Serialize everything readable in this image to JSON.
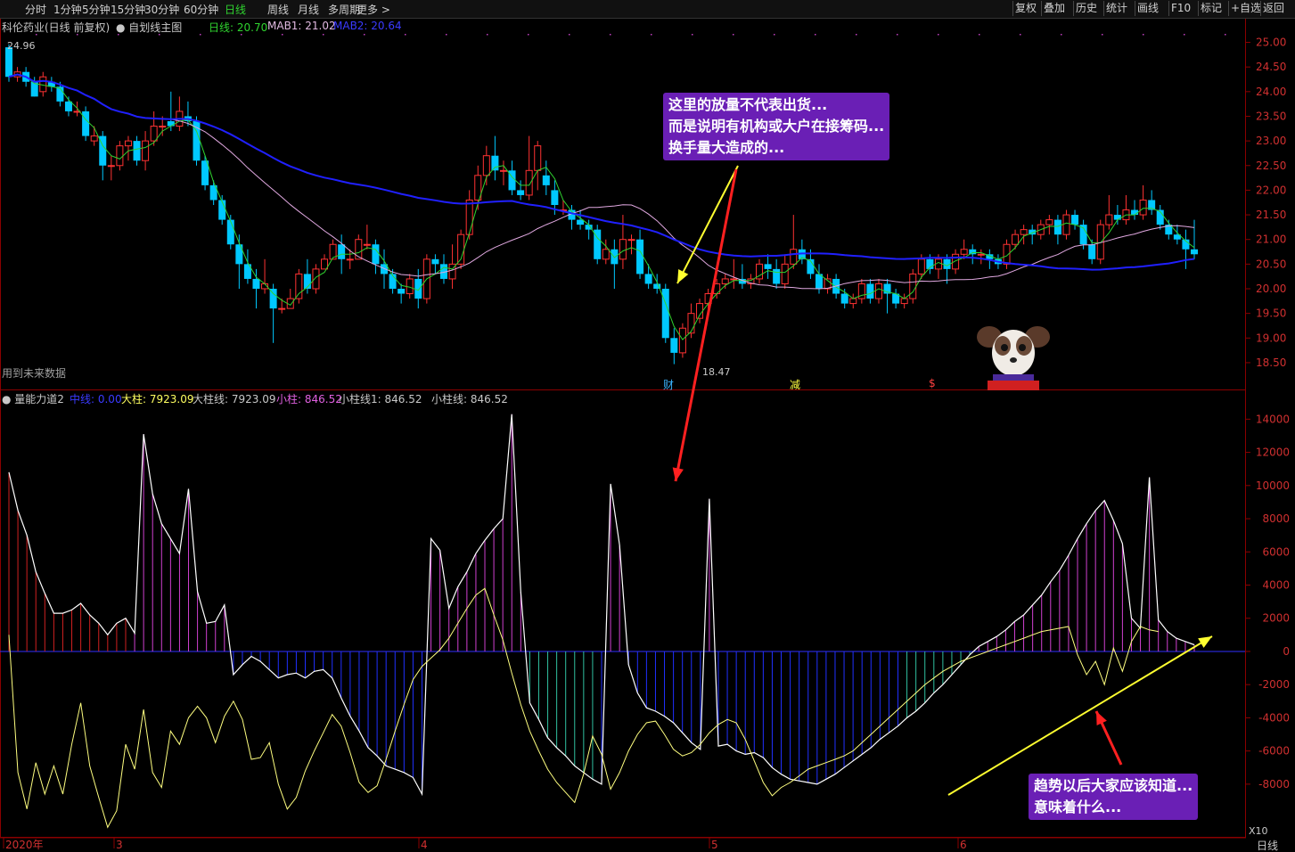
{
  "toolbar": {
    "periods": [
      "分时",
      "1分钟",
      "5分钟",
      "15分钟",
      "30分钟",
      "60分钟",
      "日线",
      "周线",
      "月线",
      "多周期",
      "更多 >"
    ],
    "active_period": "日线",
    "right_buttons": [
      "复权",
      "叠加",
      "历史",
      "统计",
      "画线",
      "F10",
      "标记",
      "+自选",
      "返回"
    ]
  },
  "main_legend": {
    "stock": "科伦药业(日线 前复权)",
    "template": "自划线主图",
    "ma_day": "日线: 20.70",
    "mab1": "MAB1: 21.02",
    "mab2": "MAB2: 20.64",
    "high_label": "24.96",
    "low_label": "18.47",
    "future_note": "用到未来数据"
  },
  "markers": [
    "财",
    "减",
    "$"
  ],
  "sub_legend": {
    "name": "量能力道2",
    "mid": "中线: 0.00",
    "big": "大柱: 7923.09",
    "big_line": "大柱线: 7923.09",
    "small": "小柱: 846.52",
    "small_line1": "小柱线1: 846.52",
    "small_line": "小柱线: 846.52"
  },
  "annotations": {
    "top": [
      "这里的放量不代表出货...",
      "而是说明有机构或大户在接筹码...",
      "换手量大造成的..."
    ],
    "bottom": [
      "趋势以后大家应该知道...",
      "意味着什么..."
    ]
  },
  "x_axis": {
    "labels": [
      "2020年",
      "3",
      "4",
      "5",
      "6"
    ],
    "period_label": "日线",
    "scale": "X10"
  },
  "colors": {
    "up": "#ff3232",
    "down": "#00c8ff",
    "ma_day": "#2fd32f",
    "mab1": "#e0a8e0",
    "mab2": "#2020ff",
    "bubble": "#6a1fb5"
  },
  "chart_data": [
    {
      "type": "candlestick",
      "y_ticks": [
        "25.00",
        "24.50",
        "24.00",
        "23.50",
        "23.00",
        "22.50",
        "22.00",
        "21.50",
        "21.00",
        "20.50",
        "20.00",
        "19.50",
        "19.00",
        "18.50"
      ],
      "ylim": [
        18.3,
        25.1
      ],
      "candles": [
        [
          24.9,
          24.3,
          24.96,
          24.2
        ],
        [
          24.3,
          24.4,
          24.5,
          24.2
        ],
        [
          24.4,
          24.2,
          24.5,
          24.1
        ],
        [
          24.2,
          23.9,
          24.3,
          23.9
        ],
        [
          24.0,
          24.3,
          24.4,
          23.9
        ],
        [
          24.2,
          24.1,
          24.3,
          24.0
        ],
        [
          24.1,
          23.8,
          24.2,
          23.7
        ],
        [
          23.8,
          23.6,
          23.9,
          23.5
        ],
        [
          23.6,
          23.6,
          23.8,
          23.5
        ],
        [
          23.6,
          23.1,
          23.7,
          23.0
        ],
        [
          23.0,
          23.1,
          23.3,
          22.9
        ],
        [
          23.1,
          22.5,
          23.2,
          22.2
        ],
        [
          22.5,
          22.5,
          22.7,
          22.2
        ],
        [
          22.5,
          22.9,
          23.0,
          22.4
        ],
        [
          22.9,
          23.0,
          23.1,
          22.6
        ],
        [
          23.0,
          22.6,
          23.1,
          22.5
        ],
        [
          22.6,
          23.0,
          23.2,
          22.4
        ],
        [
          23.0,
          23.3,
          23.6,
          22.9
        ],
        [
          23.3,
          23.3,
          23.5,
          23.1
        ],
        [
          23.4,
          23.3,
          24.0,
          23.2
        ],
        [
          23.3,
          23.6,
          23.9,
          23.2
        ],
        [
          23.5,
          23.4,
          23.8,
          23.3
        ],
        [
          23.4,
          22.6,
          23.5,
          22.5
        ],
        [
          22.6,
          22.1,
          22.7,
          22.0
        ],
        [
          22.1,
          21.8,
          22.2,
          21.7
        ],
        [
          21.8,
          21.4,
          21.9,
          21.3
        ],
        [
          21.4,
          20.9,
          21.5,
          20.8
        ],
        [
          20.9,
          20.5,
          21.1,
          20.0
        ],
        [
          20.5,
          20.2,
          20.8,
          20.1
        ],
        [
          20.2,
          20.0,
          20.4,
          19.6
        ],
        [
          20.0,
          20.1,
          20.6,
          19.9
        ],
        [
          20.0,
          19.6,
          20.1,
          18.9
        ],
        [
          19.6,
          19.6,
          19.8,
          19.5
        ],
        [
          19.6,
          19.8,
          20.0,
          19.7
        ],
        [
          19.8,
          20.3,
          20.4,
          19.7
        ],
        [
          20.3,
          20.0,
          20.6,
          19.9
        ],
        [
          20.0,
          20.4,
          20.5,
          19.9
        ],
        [
          20.4,
          20.6,
          20.7,
          20.4
        ],
        [
          20.6,
          20.9,
          21.0,
          20.6
        ],
        [
          20.9,
          20.6,
          21.1,
          20.3
        ],
        [
          20.6,
          20.6,
          20.8,
          20.4
        ],
        [
          20.6,
          21.0,
          21.1,
          20.6
        ],
        [
          20.9,
          20.9,
          21.3,
          20.8
        ],
        [
          20.9,
          20.5,
          21.0,
          20.3
        ],
        [
          20.5,
          20.3,
          20.8,
          20.0
        ],
        [
          20.3,
          20.0,
          20.4,
          19.9
        ],
        [
          20.0,
          19.9,
          20.1,
          19.7
        ],
        [
          19.9,
          20.2,
          20.3,
          19.8
        ],
        [
          20.2,
          19.8,
          20.4,
          19.6
        ],
        [
          19.8,
          20.6,
          20.7,
          19.7
        ],
        [
          20.6,
          20.5,
          20.7,
          20.3
        ],
        [
          20.5,
          20.2,
          20.7,
          20.1
        ],
        [
          20.2,
          20.5,
          20.9,
          20.0
        ],
        [
          20.5,
          21.1,
          21.2,
          20.4
        ],
        [
          21.1,
          21.8,
          22.0,
          21.0
        ],
        [
          21.8,
          22.3,
          22.5,
          21.6
        ],
        [
          22.3,
          22.7,
          22.9,
          22.1
        ],
        [
          22.7,
          22.4,
          23.1,
          22.2
        ],
        [
          22.4,
          22.4,
          22.6,
          22.1
        ],
        [
          22.4,
          22.0,
          22.6,
          21.9
        ],
        [
          22.0,
          21.9,
          22.2,
          21.8
        ],
        [
          21.9,
          22.4,
          23.1,
          21.8
        ],
        [
          22.4,
          22.9,
          23.0,
          22.0
        ],
        [
          22.3,
          22.1,
          22.6,
          21.9
        ],
        [
          22.0,
          21.7,
          22.2,
          21.5
        ],
        [
          21.6,
          21.6,
          21.8,
          21.5
        ],
        [
          21.6,
          21.4,
          21.7,
          21.2
        ],
        [
          21.4,
          21.3,
          21.6,
          21.2
        ],
        [
          21.3,
          21.2,
          21.4,
          21.0
        ],
        [
          21.2,
          20.6,
          21.3,
          20.5
        ],
        [
          20.6,
          20.8,
          21.0,
          20.5
        ],
        [
          20.8,
          20.5,
          21.0,
          20.0
        ],
        [
          20.6,
          21.0,
          21.5,
          20.4
        ],
        [
          21.0,
          21.0,
          21.1,
          20.7
        ],
        [
          21.0,
          20.3,
          21.2,
          20.2
        ],
        [
          20.3,
          20.1,
          20.5,
          20.0
        ],
        [
          20.1,
          20.0,
          20.3,
          19.9
        ],
        [
          20.0,
          19.0,
          20.1,
          18.9
        ],
        [
          19.0,
          18.7,
          19.2,
          18.47
        ],
        [
          18.7,
          19.2,
          19.3,
          18.6
        ],
        [
          19.1,
          19.5,
          19.7,
          19.0
        ],
        [
          19.4,
          19.7,
          19.8,
          19.3
        ],
        [
          19.7,
          19.9,
          20.0,
          19.6
        ],
        [
          19.9,
          20.1,
          20.2,
          19.8
        ],
        [
          20.1,
          20.2,
          20.3,
          20.0
        ],
        [
          20.2,
          20.2,
          20.6,
          20.0
        ],
        [
          20.2,
          20.1,
          20.5,
          20.0
        ],
        [
          20.1,
          20.2,
          20.3,
          20.0
        ],
        [
          20.2,
          20.5,
          20.6,
          20.1
        ],
        [
          20.5,
          20.4,
          20.7,
          20.2
        ],
        [
          20.4,
          20.1,
          20.6,
          20.0
        ],
        [
          20.1,
          20.5,
          20.7,
          20.0
        ],
        [
          20.5,
          20.8,
          21.5,
          20.4
        ],
        [
          20.8,
          20.6,
          21.0,
          20.5
        ],
        [
          20.6,
          20.3,
          20.8,
          20.2
        ],
        [
          20.3,
          20.0,
          20.5,
          19.9
        ],
        [
          20.0,
          20.2,
          20.3,
          19.9
        ],
        [
          20.2,
          19.9,
          20.3,
          19.8
        ],
        [
          19.9,
          19.7,
          20.0,
          19.6
        ],
        [
          19.7,
          19.8,
          19.9,
          19.6
        ],
        [
          19.8,
          20.1,
          20.2,
          19.7
        ],
        [
          20.1,
          19.8,
          20.2,
          19.7
        ],
        [
          19.8,
          20.1,
          20.2,
          19.7
        ],
        [
          20.1,
          19.9,
          20.2,
          19.5
        ],
        [
          19.9,
          19.7,
          20.0,
          19.6
        ],
        [
          19.7,
          19.8,
          19.9,
          19.6
        ],
        [
          19.8,
          20.3,
          20.4,
          19.7
        ],
        [
          20.3,
          20.6,
          20.7,
          20.2
        ],
        [
          20.6,
          20.4,
          20.7,
          20.3
        ],
        [
          20.4,
          20.6,
          20.7,
          20.2
        ],
        [
          20.6,
          20.4,
          20.7,
          20.1
        ],
        [
          20.4,
          20.7,
          20.8,
          20.3
        ],
        [
          20.7,
          20.8,
          21.0,
          20.6
        ],
        [
          20.8,
          20.7,
          20.9,
          20.5
        ],
        [
          20.7,
          20.7,
          20.8,
          20.5
        ],
        [
          20.7,
          20.6,
          20.8,
          20.4
        ],
        [
          20.6,
          20.5,
          20.7,
          20.4
        ],
        [
          20.5,
          20.9,
          21.0,
          20.4
        ],
        [
          20.9,
          21.1,
          21.2,
          20.8
        ],
        [
          21.1,
          21.2,
          21.3,
          20.9
        ],
        [
          21.2,
          21.1,
          21.3,
          20.9
        ],
        [
          21.1,
          21.3,
          21.4,
          21.0
        ],
        [
          21.3,
          21.4,
          21.5,
          21.1
        ],
        [
          21.4,
          21.1,
          21.5,
          20.9
        ],
        [
          21.1,
          21.5,
          21.6,
          21.0
        ],
        [
          21.5,
          21.3,
          21.6,
          21.2
        ],
        [
          21.3,
          20.9,
          21.4,
          20.8
        ],
        [
          20.9,
          20.6,
          21.0,
          20.5
        ],
        [
          20.6,
          21.3,
          21.4,
          20.5
        ],
        [
          21.3,
          21.5,
          21.9,
          21.2
        ],
        [
          21.5,
          21.4,
          21.7,
          21.3
        ],
        [
          21.4,
          21.6,
          21.9,
          21.3
        ],
        [
          21.6,
          21.5,
          21.8,
          21.4
        ],
        [
          21.5,
          21.8,
          22.1,
          21.4
        ],
        [
          21.8,
          21.6,
          22.0,
          21.5
        ],
        [
          21.6,
          21.3,
          21.7,
          21.2
        ],
        [
          21.3,
          21.1,
          21.4,
          21.0
        ],
        [
          21.1,
          21.0,
          21.3,
          20.9
        ],
        [
          21.0,
          20.8,
          21.2,
          20.4
        ],
        [
          20.8,
          20.7,
          21.4,
          20.6
        ]
      ],
      "ma_day_label": "日线",
      "mab1_label": "MAB1",
      "mab2_label": "MAB2"
    },
    {
      "type": "bar_line",
      "y_ticks": [
        "14000",
        "12000",
        "10000",
        "8000",
        "6000",
        "4000",
        "2000",
        "0",
        "-2000",
        "-4000",
        "-6000",
        "-8000"
      ],
      "ylim": [
        -10800,
        15200
      ],
      "big_bars": [
        10800,
        8500,
        7000,
        4800,
        3500,
        2300,
        2300,
        2500,
        2900,
        2200,
        1700,
        1000,
        1700,
        2000,
        1100,
        13100,
        9500,
        7700,
        6800,
        5900,
        9800,
        3600,
        1700,
        1800,
        2800,
        -1400,
        -800,
        -300,
        -600,
        -1100,
        -1600,
        -1400,
        -1300,
        -1600,
        -1200,
        -1100,
        -1600,
        -2800,
        -3900,
        -4800,
        -5800,
        -6300,
        -6900,
        -7100,
        -7300,
        -7600,
        -8600,
        6800,
        6100,
        2600,
        3900,
        4800,
        5900,
        6700,
        7400,
        8000,
        14300,
        3600,
        -3100,
        -4100,
        -5200,
        -5800,
        -6300,
        -6900,
        -7300,
        -7700,
        -8000,
        10100,
        6400,
        -800,
        -2500,
        -3400,
        -3600,
        -3900,
        -4300,
        -4900,
        -5500,
        -5900,
        9200,
        -5700,
        -5600,
        -6000,
        -6200,
        -6100,
        -6400,
        -7000,
        -7400,
        -7700,
        -7800,
        -7900,
        -8000,
        -7700,
        -7400,
        -7000,
        -6600,
        -6200,
        -5800,
        -5300,
        -4900,
        -4500,
        -4000,
        -3600,
        -3100,
        -2500,
        -2000,
        -1400,
        -800,
        -200,
        300,
        600,
        900,
        1300,
        1800,
        2200,
        2800,
        3400,
        4200,
        4900,
        5800,
        6800,
        7700,
        8500,
        9100,
        7900,
        6500,
        2000,
        1400,
        10500,
        1900,
        1200,
        800,
        600,
        400
      ],
      "small_line": [
        1000,
        -7300,
        -9500,
        -6700,
        -8600,
        -6900,
        -8600,
        -5600,
        -3100,
        -6900,
        -8800,
        -10600,
        -9600,
        -5600,
        -7100,
        -3500,
        -7300,
        -8200,
        -4800,
        -5600,
        -4000,
        -3300,
        -4000,
        -5500,
        -3900,
        -3000,
        -4100,
        -6500,
        -6400,
        -5500,
        -8000,
        -9500,
        -8800,
        -7200,
        -6000,
        -4900,
        -3800,
        -4500,
        -6100,
        -7900,
        -8500,
        -8100,
        -6500,
        -4800,
        -3200,
        -1700,
        -900,
        -400,
        100,
        800,
        1700,
        2600,
        3400,
        3800,
        2200,
        700,
        -1300,
        -3200,
        -4800,
        -6000,
        -7100,
        -7900,
        -8500,
        -9100,
        -7400,
        -5100,
        -6200,
        -8300,
        -7300,
        -6000,
        -5000,
        -4300,
        -4200,
        -5000,
        -5900,
        -6300,
        -6100,
        -5600,
        -4900,
        -4400,
        -4100,
        -4300,
        -5300,
        -6600,
        -7900,
        -8700,
        -8200,
        -7900,
        -7500,
        -7100,
        -6900,
        -6700,
        -6500,
        -6300,
        -6000,
        -5500,
        -5000,
        -4500,
        -4000,
        -3500,
        -3000,
        -2500,
        -2000,
        -1600,
        -1200,
        -900,
        -600,
        -400,
        -200,
        0,
        200,
        400,
        600,
        800,
        1000,
        1200,
        1300,
        1400,
        1500,
        -200,
        -1400,
        -600,
        -2000,
        200,
        -1200,
        600,
        1500,
        1300,
        1200
      ],
      "big_line_label": "大柱线",
      "small_line_label": "小柱线"
    }
  ]
}
